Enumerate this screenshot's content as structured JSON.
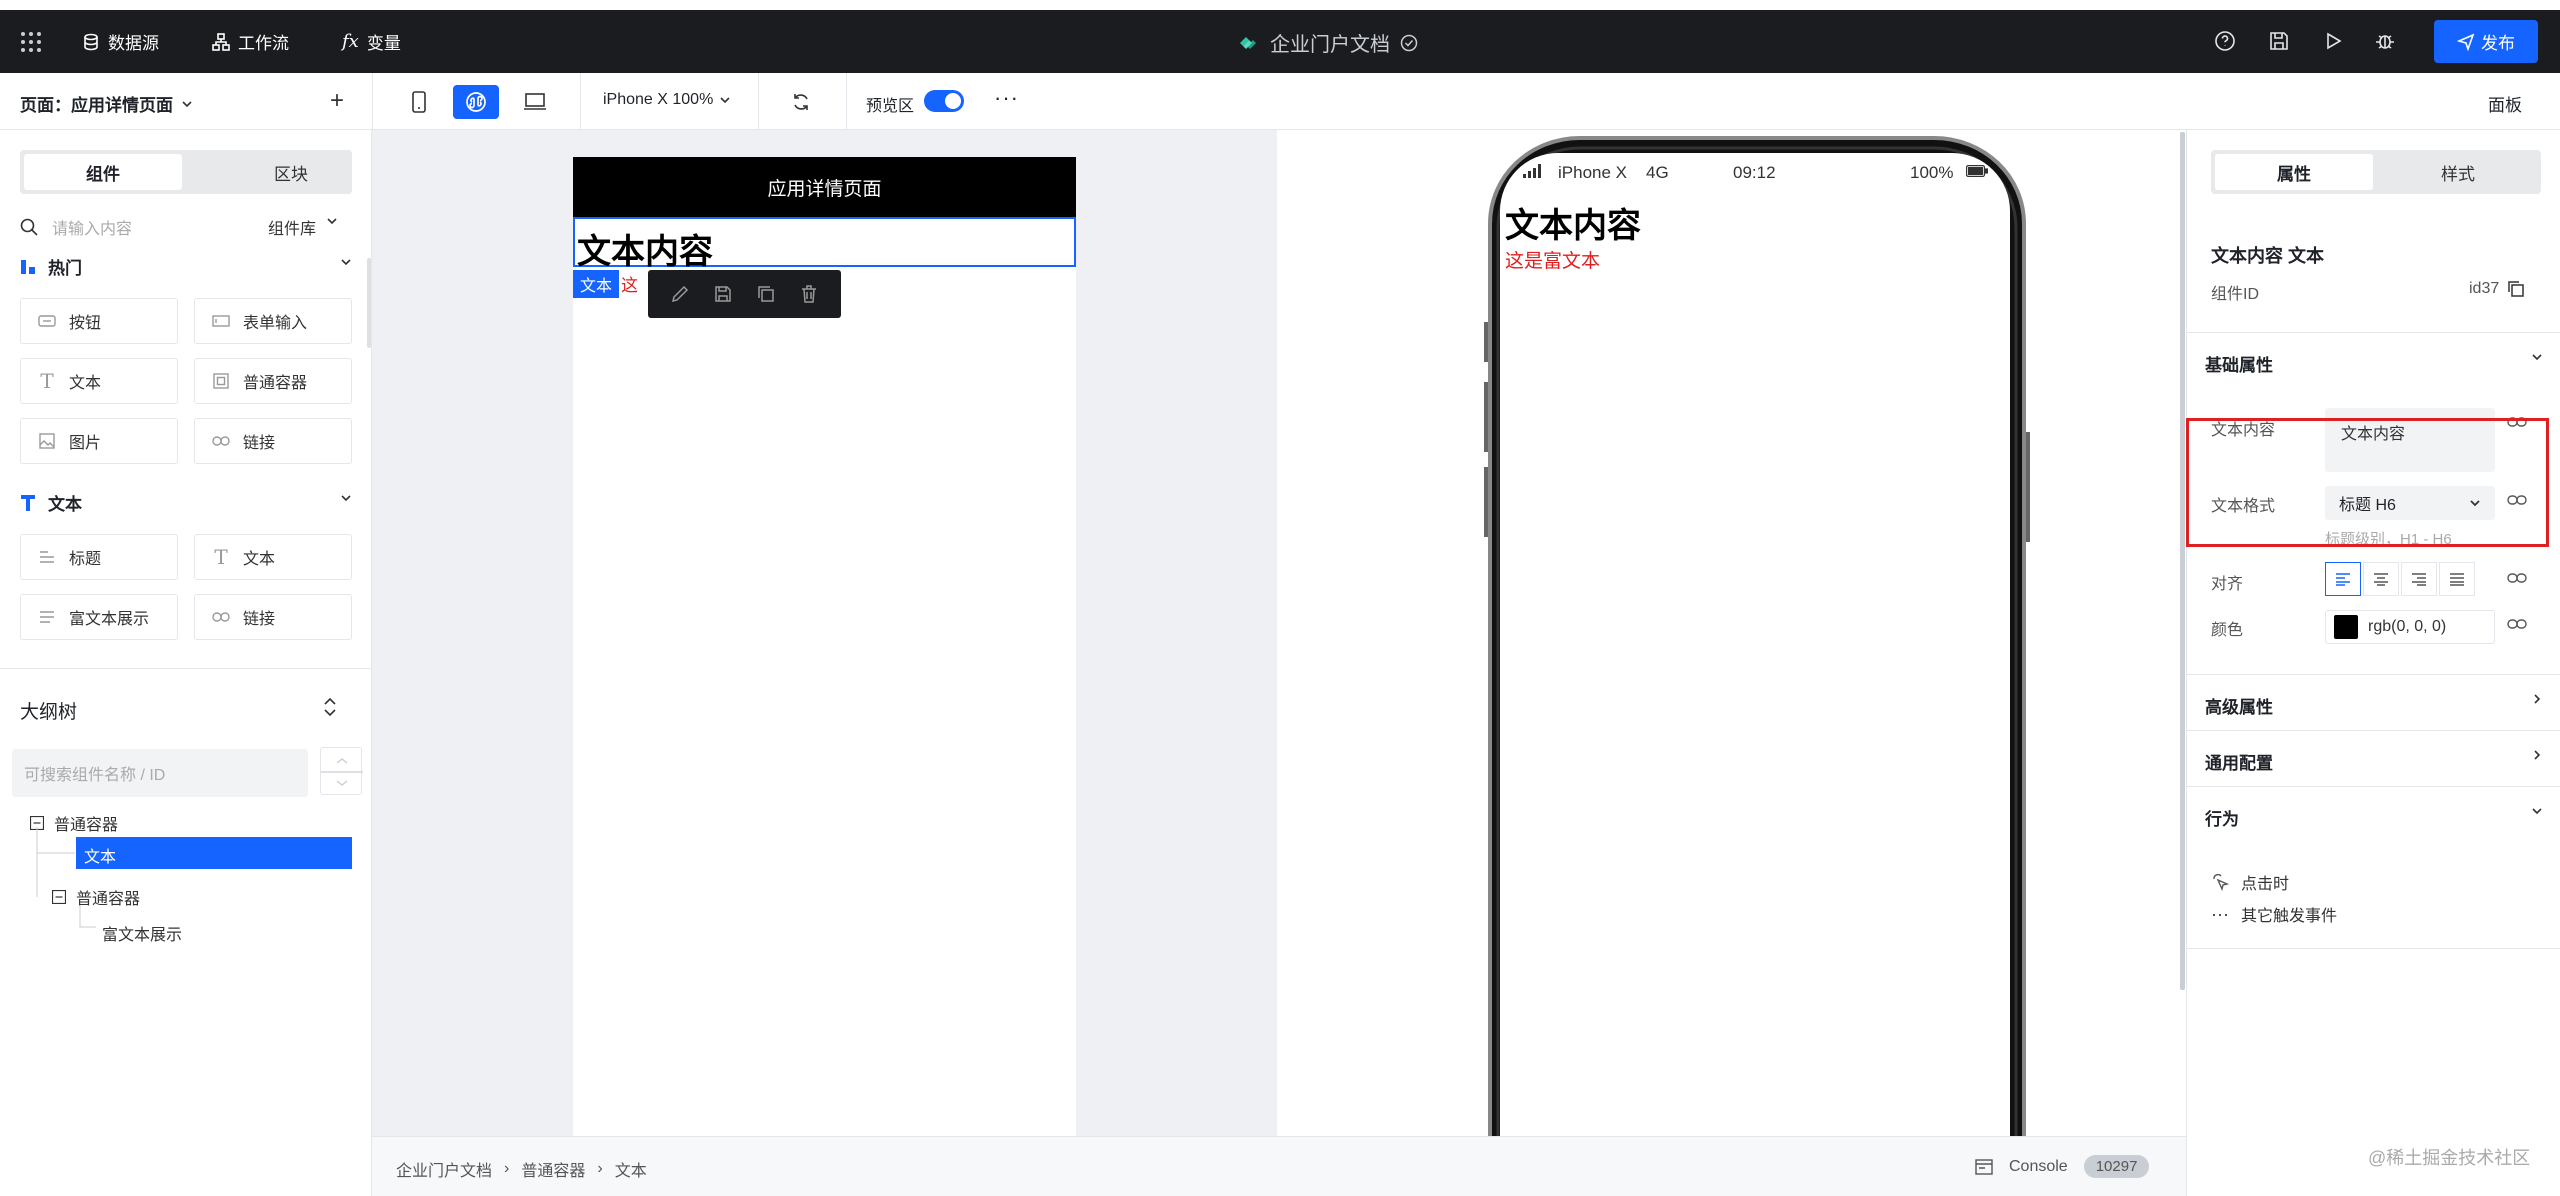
{
  "topbar": {
    "datasource": "数据源",
    "workflow": "工作流",
    "variables": "变量",
    "app_title": "企业门户文档",
    "publish": "发布"
  },
  "toolbar": {
    "page_select": "页面：应用详情页面",
    "device": "iPhone X 100%",
    "preview_label": "预览区",
    "panel_label": "面板"
  },
  "left": {
    "tab_components": "组件",
    "tab_blocks": "区块",
    "search_placeholder": "请输入内容",
    "library": "组件库",
    "cat_hot": "热门",
    "hot": [
      "按钮",
      "表单输入",
      "文本",
      "普通容器",
      "图片",
      "链接"
    ],
    "cat_text": "文本",
    "text": [
      "标题",
      "文本",
      "富文本展示",
      "链接"
    ]
  },
  "outline": {
    "title": "大纲树",
    "search_placeholder": "可搜索组件名称 / ID",
    "nodes": [
      "普通容器",
      "文本",
      "普通容器",
      "富文本展示"
    ]
  },
  "canvas": {
    "page_header": "应用详情页面",
    "selected_text": "文本内容",
    "selected_tag": "文本",
    "peek_text": "这"
  },
  "phone": {
    "carrier": "iPhone X",
    "network": "4G",
    "time": "09:12",
    "battery": "100%",
    "title": "文本内容",
    "rich": "这是富文本"
  },
  "bottom": {
    "crumbs": [
      "企业门户文档",
      "普通容器",
      "文本"
    ],
    "console": "Console",
    "count": "10297"
  },
  "right": {
    "tab_props": "属性",
    "tab_style": "样式",
    "comp_title": "文本内容 文本",
    "comp_id_label": "组件ID",
    "comp_id": "id37",
    "basic": "基础属性",
    "content_label": "文本内容",
    "content_value": "文本内容",
    "format_label": "文本格式",
    "format_value": "标题 H6",
    "format_hint": "标题级别，H1 - H6",
    "align_label": "对齐",
    "color_label": "颜色",
    "color_value": "rgb(0, 0, 0)",
    "advanced": "高级属性",
    "common": "通用配置",
    "behavior": "行为",
    "on_click": "点击时",
    "other_events": "其它触发事件"
  },
  "watermark": "@稀土掘金技术社区",
  "colors": {
    "accent": "#1664ff",
    "highlight": "#e02020"
  }
}
